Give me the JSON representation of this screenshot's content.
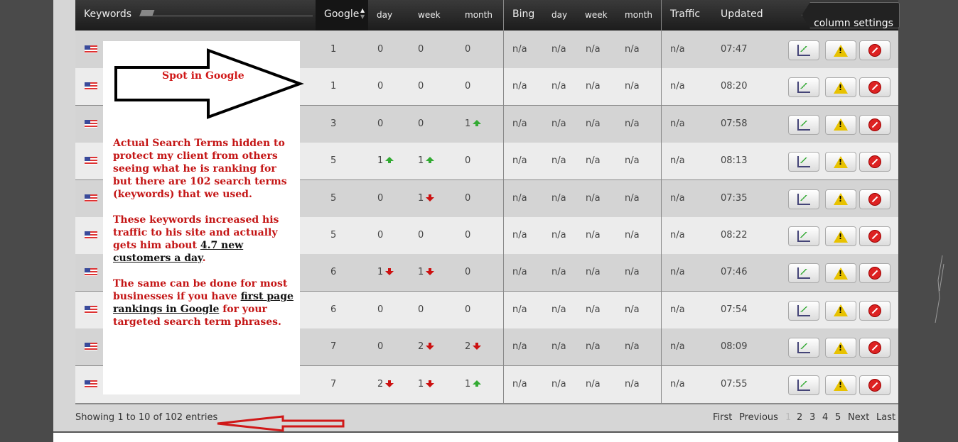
{
  "header": {
    "keywords": "Keywords",
    "google": "Google",
    "day": "day",
    "week": "week",
    "month": "month",
    "bing": "Bing",
    "bing_day": "day",
    "bing_week": "week",
    "bing_month": "month",
    "traffic": "Traffic",
    "updated": "Updated",
    "column_settings": "column settings"
  },
  "rows": [
    {
      "google": "1",
      "day": "0",
      "day_dir": "",
      "week": "0",
      "week_dir": "",
      "month": "0",
      "month_dir": "",
      "bing": "n/a",
      "bing_day": "n/a",
      "bing_week": "n/a",
      "bing_month": "n/a",
      "traffic": "n/a",
      "updated": "07:47"
    },
    {
      "google": "1",
      "day": "0",
      "day_dir": "",
      "week": "0",
      "week_dir": "",
      "month": "0",
      "month_dir": "",
      "bing": "n/a",
      "bing_day": "n/a",
      "bing_week": "n/a",
      "bing_month": "n/a",
      "traffic": "n/a",
      "updated": "08:20"
    },
    {
      "google": "3",
      "day": "0",
      "day_dir": "",
      "week": "0",
      "week_dir": "",
      "month": "1",
      "month_dir": "up",
      "bing": "n/a",
      "bing_day": "n/a",
      "bing_week": "n/a",
      "bing_month": "n/a",
      "traffic": "n/a",
      "updated": "07:58"
    },
    {
      "google": "5",
      "day": "1",
      "day_dir": "up",
      "week": "1",
      "week_dir": "up",
      "month": "0",
      "month_dir": "",
      "bing": "n/a",
      "bing_day": "n/a",
      "bing_week": "n/a",
      "bing_month": "n/a",
      "traffic": "n/a",
      "updated": "08:13"
    },
    {
      "google": "5",
      "day": "0",
      "day_dir": "",
      "week": "1",
      "week_dir": "down",
      "month": "0",
      "month_dir": "",
      "bing": "n/a",
      "bing_day": "n/a",
      "bing_week": "n/a",
      "bing_month": "n/a",
      "traffic": "n/a",
      "updated": "07:35"
    },
    {
      "google": "5",
      "day": "0",
      "day_dir": "",
      "week": "0",
      "week_dir": "",
      "month": "0",
      "month_dir": "",
      "bing": "n/a",
      "bing_day": "n/a",
      "bing_week": "n/a",
      "bing_month": "n/a",
      "traffic": "n/a",
      "updated": "08:22"
    },
    {
      "google": "6",
      "day": "1",
      "day_dir": "down",
      "week": "1",
      "week_dir": "down",
      "month": "0",
      "month_dir": "",
      "bing": "n/a",
      "bing_day": "n/a",
      "bing_week": "n/a",
      "bing_month": "n/a",
      "traffic": "n/a",
      "updated": "07:46"
    },
    {
      "google": "6",
      "day": "0",
      "day_dir": "",
      "week": "0",
      "week_dir": "",
      "month": "0",
      "month_dir": "",
      "bing": "n/a",
      "bing_day": "n/a",
      "bing_week": "n/a",
      "bing_month": "n/a",
      "traffic": "n/a",
      "updated": "07:54"
    },
    {
      "google": "7",
      "day": "0",
      "day_dir": "",
      "week": "2",
      "week_dir": "down",
      "month": "2",
      "month_dir": "down",
      "bing": "n/a",
      "bing_day": "n/a",
      "bing_week": "n/a",
      "bing_month": "n/a",
      "traffic": "n/a",
      "updated": "08:09"
    },
    {
      "google": "7",
      "day": "2",
      "day_dir": "down",
      "week": "1",
      "week_dir": "down",
      "month": "1",
      "month_dir": "up",
      "bing": "n/a",
      "bing_day": "n/a",
      "bing_week": "n/a",
      "bing_month": "n/a",
      "traffic": "n/a",
      "updated": "07:55"
    }
  ],
  "annotation": {
    "spot_label": "Spot in Google",
    "para1": "Actual Search Terms hidden to protect my client from others seeing what he is ranking for but there are 102 search terms (keywords) that we used.",
    "para2_a": "These keywords increased his traffic to his site and actually gets him about ",
    "para2_u": "4.7 new customers a day",
    "para2_b": ".",
    "para3_a": "The same can be done for most businesses if you have ",
    "para3_u": "first page rankings in Google",
    "para3_b": " for your targeted search term phrases."
  },
  "footer": {
    "info": "Showing 1 to 10 of 102 entries",
    "first": "First",
    "previous": "Previous",
    "pages": [
      "1",
      "2",
      "3",
      "4",
      "5"
    ],
    "next": "Next",
    "last": "Last"
  },
  "colors": {
    "arrow_red": "#d01818",
    "trend_up": "#33aa33",
    "trend_down": "#cc1111",
    "header_bg": "#1c1c1c"
  }
}
